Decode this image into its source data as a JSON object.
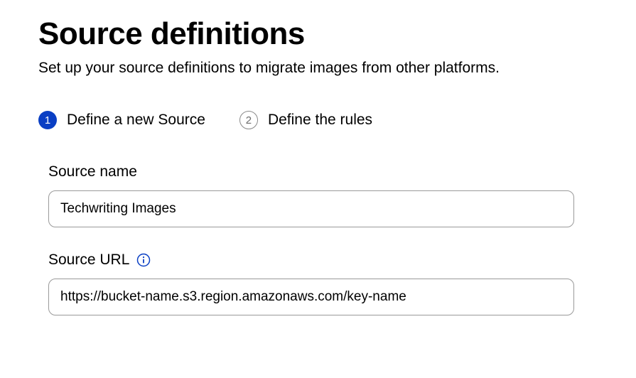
{
  "header": {
    "title": "Source definitions",
    "subtitle": "Set up your source definitions to migrate images from other platforms."
  },
  "steps": [
    {
      "number": "1",
      "label": "Define a new Source",
      "active": true
    },
    {
      "number": "2",
      "label": "Define the rules",
      "active": false
    }
  ],
  "form": {
    "source_name": {
      "label": "Source name",
      "value": "Techwriting Images"
    },
    "source_url": {
      "label": "Source URL",
      "value": "https://bucket-name.s3.region.amazonaws.com/key-name"
    }
  },
  "colors": {
    "primary": "#0a3fc4"
  }
}
